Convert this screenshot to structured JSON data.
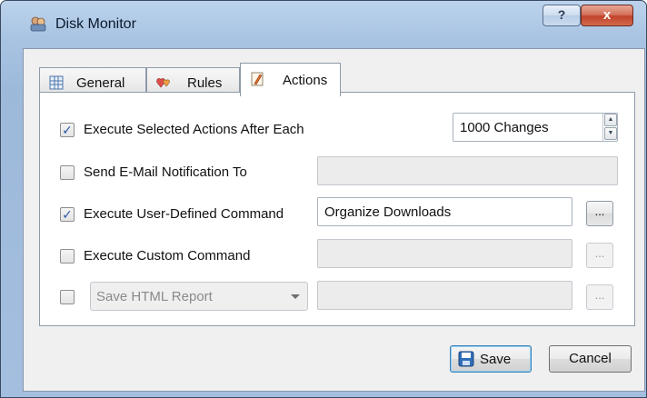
{
  "window": {
    "title": "Disk Monitor",
    "help_label": "?",
    "close_label": "x"
  },
  "tabs": [
    {
      "label": "General",
      "icon": "grid-icon",
      "active": false
    },
    {
      "label": "Rules",
      "icon": "hearts-icon",
      "active": false
    },
    {
      "label": "Actions",
      "icon": "pencil-icon",
      "active": true
    }
  ],
  "actions": {
    "execute_after": {
      "checked": true,
      "label": "Execute Selected Actions After Each",
      "value": "1000 Changes"
    },
    "email": {
      "checked": false,
      "label": "Send E-Mail Notification To",
      "value": ""
    },
    "user_command": {
      "checked": true,
      "label": "Execute User-Defined Command",
      "value": "Organize Downloads",
      "browse_label": "..."
    },
    "custom_command": {
      "checked": false,
      "label": "Execute Custom Command",
      "value": "",
      "browse_label": "..."
    },
    "report": {
      "checked": false,
      "selected": "Save HTML Report",
      "value": "",
      "browse_label": "..."
    }
  },
  "buttons": {
    "save_label": "Save",
    "cancel_label": "Cancel"
  },
  "colors": {
    "accent": "#2a56a8",
    "close_red": "#c1432b",
    "frame_blue": "#a9c4e3"
  }
}
